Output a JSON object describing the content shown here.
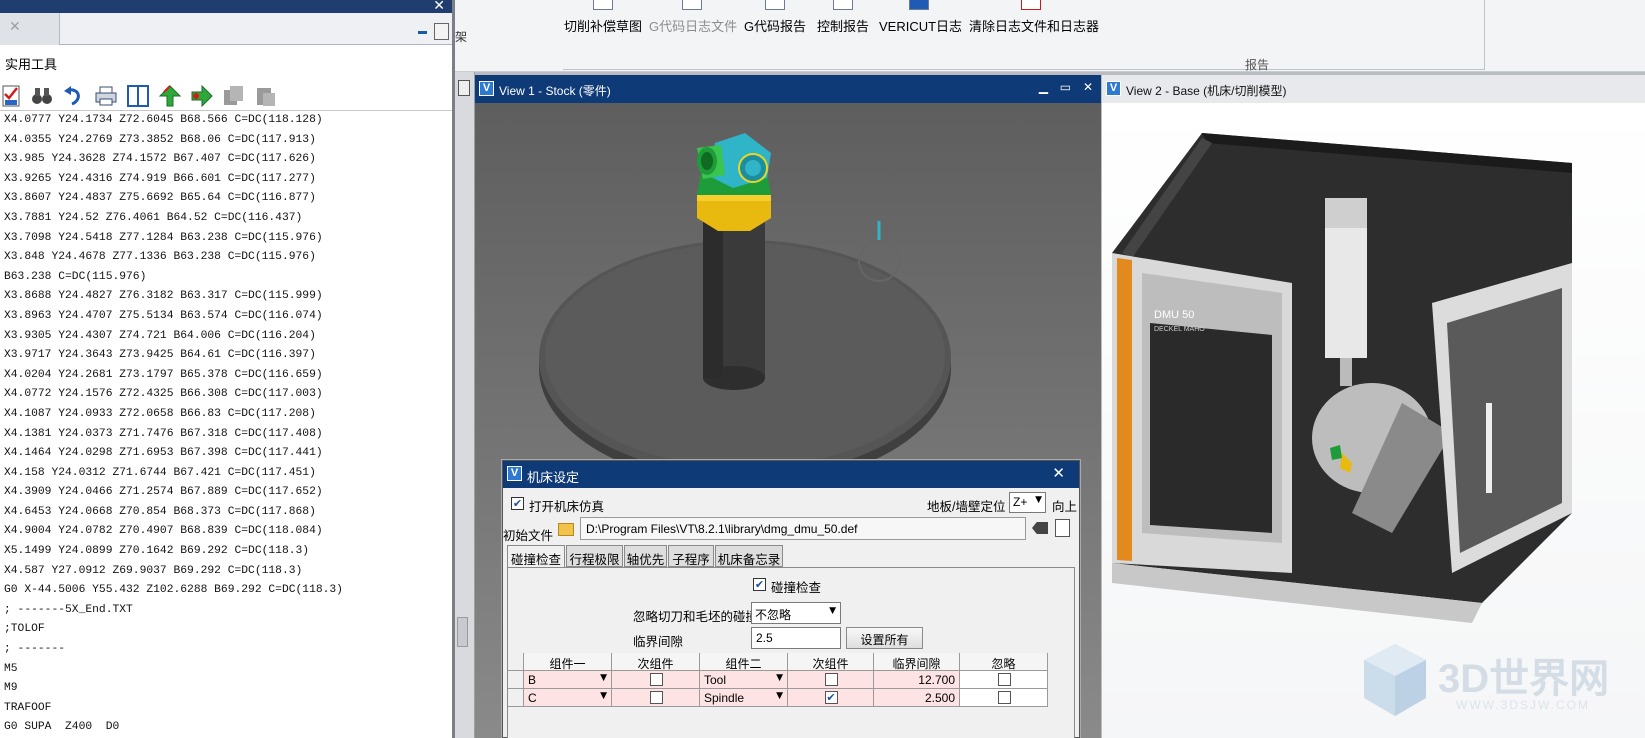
{
  "left_panel": {
    "title": "实用工具",
    "code_lines": [
      "X4.0777 Y24.1734 Z72.6045 B68.566 C=DC(118.128)",
      "X4.0355 Y24.2769 Z73.3852 B68.06 C=DC(117.913)",
      "X3.985 Y24.3628 Z74.1572 B67.407 C=DC(117.626)",
      "X3.9265 Y24.4316 Z74.919 B66.601 C=DC(117.277)",
      "X3.8607 Y24.4837 Z75.6692 B65.64 C=DC(116.877)",
      "X3.7881 Y24.52 Z76.4061 B64.52 C=DC(116.437)",
      "X3.7098 Y24.5418 Z77.1284 B63.238 C=DC(115.976)",
      "X3.848 Y24.4678 Z77.1336 B63.238 C=DC(115.976)",
      "B63.238 C=DC(115.976)",
      "X3.8688 Y24.4827 Z76.3182 B63.317 C=DC(115.999)",
      "X3.8963 Y24.4707 Z75.5134 B63.574 C=DC(116.074)",
      "X3.9305 Y24.4307 Z74.721 B64.006 C=DC(116.204)",
      "X3.9717 Y24.3643 Z73.9425 B64.61 C=DC(116.397)",
      "X4.0204 Y24.2681 Z73.1797 B65.378 C=DC(116.659)",
      "X4.0772 Y24.1576 Z72.4325 B66.308 C=DC(117.003)",
      "X4.1087 Y24.0933 Z72.0658 B66.83 C=DC(117.208)",
      "X4.1381 Y24.0373 Z71.7476 B67.318 C=DC(117.408)",
      "X4.1464 Y24.0298 Z71.6953 B67.398 C=DC(117.441)",
      "X4.158 Y24.0312 Z71.6744 B67.421 C=DC(117.451)",
      "X4.3909 Y24.0466 Z71.2574 B67.889 C=DC(117.652)",
      "X4.6453 Y24.0668 Z70.854 B68.373 C=DC(117.868)",
      "X4.9004 Y24.0782 Z70.4907 B68.839 C=DC(118.084)",
      "X5.1499 Y24.0899 Z70.1642 B69.292 C=DC(118.3)",
      "X4.587 Y27.0912 Z69.9037 B69.292 C=DC(118.3)",
      "G0 X-44.5006 Y55.432 Z102.6288 B69.292 C=DC(118.3)",
      "; -------5X_End.TXT",
      ";TOLOF",
      "; -------",
      "M5",
      "M9",
      "TRAFOOF",
      "G0 SUPA  Z400  D0"
    ]
  },
  "ribbon": {
    "left_label": "架",
    "buttons": [
      {
        "label": "切削补偿草图",
        "enabled": true
      },
      {
        "label": "G代码日志文件",
        "enabled": false
      },
      {
        "label": "G代码报告",
        "enabled": true
      },
      {
        "label": "控制报告",
        "enabled": true
      },
      {
        "label": "VERICUT日志",
        "enabled": true
      },
      {
        "label": "清除日志文件和日志器",
        "enabled": true
      }
    ],
    "group_caption": "报告"
  },
  "view1": {
    "title": "View 1 - Stock (零件)",
    "controls": "▁ ▭ ✕"
  },
  "view2": {
    "title": "View 2 - Base (机床/切削模型)",
    "machine_label": "DMU 50",
    "machine_sublabel": "DECKEL MAHO"
  },
  "dialog": {
    "title": "机床设定",
    "close": "✕",
    "enable_sim_label": "打开机床仿真",
    "enable_sim_checked": true,
    "floor_label": "地板/墙壁定位",
    "floor_value": "Z+",
    "up_label": "向上",
    "init_file_label": "初始文件",
    "init_file_path": "D:\\Program Files\\VT\\8.2.1\\library\\dmg_dmu_50.def",
    "tabs": [
      "碰撞检查",
      "行程极限",
      "轴优先",
      "子程序",
      "机床备忘录"
    ],
    "active_tab": 0,
    "collision_check_label": "碰撞检查",
    "collision_check_checked": true,
    "ignore_label": "忽略切刀和毛坯的碰撞",
    "ignore_value": "不忽略",
    "clearance_label": "临界间隙",
    "clearance_value": "2.5",
    "set_all_label": "设置所有",
    "grid": {
      "headers": [
        "组件一",
        "次组件",
        "组件二",
        "次组件",
        "临界间隙",
        "忽略"
      ],
      "rows": [
        {
          "comp1": "B",
          "sub1": false,
          "comp2": "Tool",
          "sub2": false,
          "clearance": "12.700",
          "ignore": false
        },
        {
          "comp1": "C",
          "sub1": false,
          "comp2": "Spindle",
          "sub2": true,
          "clearance": "2.500",
          "ignore": false
        }
      ]
    }
  },
  "watermark": {
    "text": "3D世界网",
    "sub": "WWW.3DSJW.COM"
  },
  "colors": {
    "title_bar": "#0f3a78",
    "grid_row": "#fde3e3",
    "stock_part": "#e8b90e",
    "fixture": "#2fb4c8"
  }
}
